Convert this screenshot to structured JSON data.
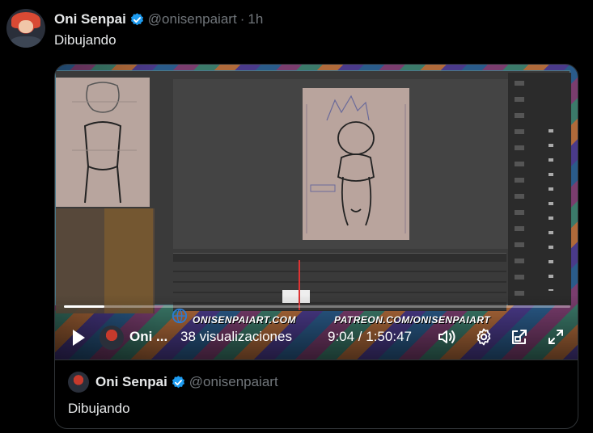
{
  "tweet": {
    "author_name": "Oni Senpai",
    "handle": "@onisenpaiart",
    "separator": "·",
    "time": "1h",
    "text": "Dibujando"
  },
  "video": {
    "progress_fraction": 0.08,
    "watermark_left": "ONISENPAIART.COM",
    "watermark_right": "PATREON.COM/ONISENPAIART",
    "channel_name": "Oni ...",
    "views": "38 visualizaciones",
    "timecode": "9:04 / 1:50:47"
  },
  "quoted": {
    "author_name": "Oni Senpai",
    "handle": "@onisenpaiart",
    "text": "Dibujando"
  },
  "icons": {
    "verified": "verified-badge-icon",
    "play": "play-icon",
    "volume": "volume-icon",
    "settings": "gear-icon",
    "pip": "picture-in-picture-icon",
    "fullscreen": "fullscreen-icon"
  },
  "colors": {
    "verified_blue": "#1d9bf0",
    "muted_text": "#71767b",
    "border": "#2f3336"
  }
}
